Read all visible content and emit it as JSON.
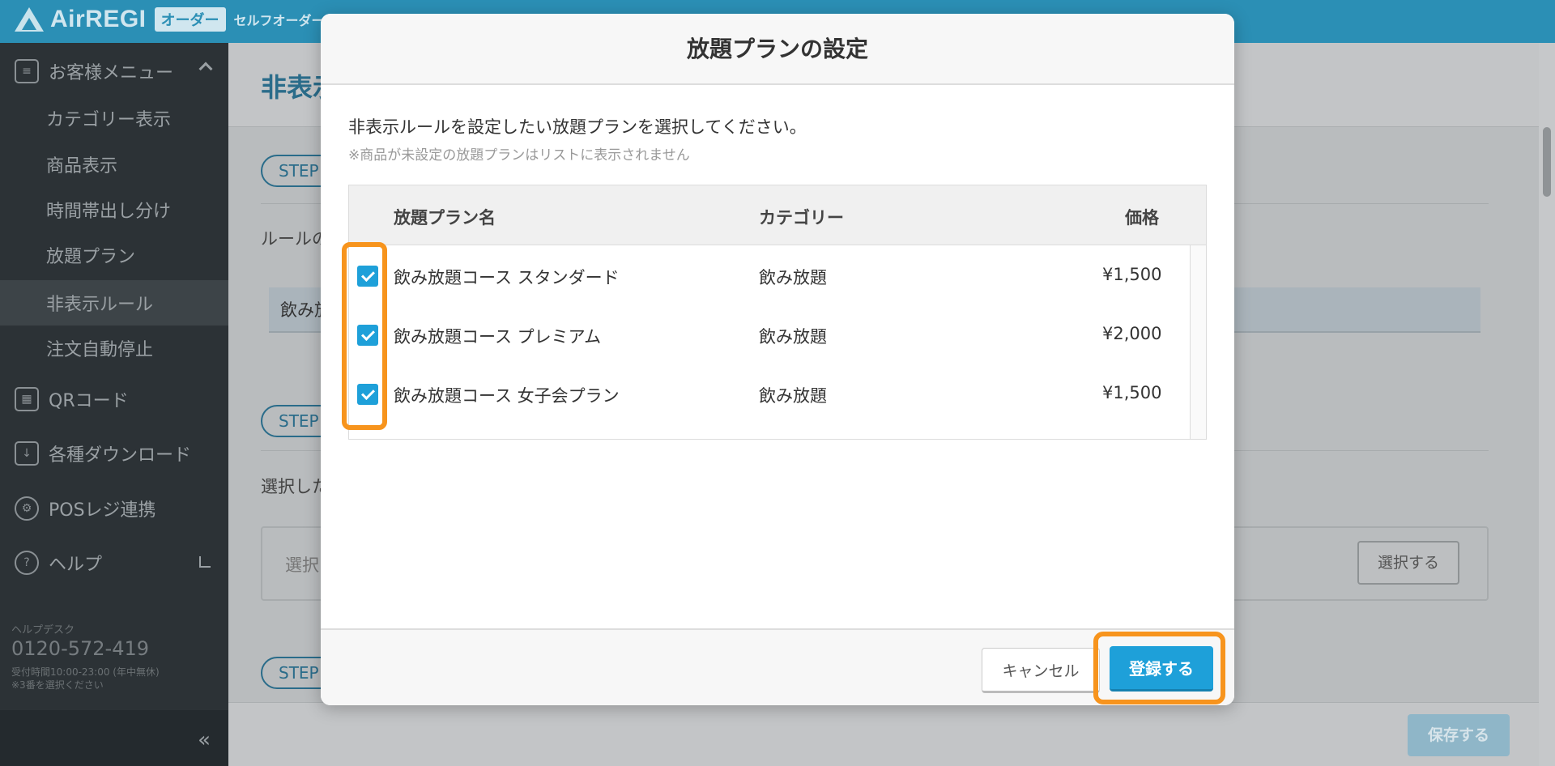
{
  "header": {
    "brand_name": "AirREGI",
    "brand_badge": "オーダー",
    "brand_sub": "セルフオーダー"
  },
  "sidebar": {
    "section_customer_menu": "お客様メニュー",
    "items": [
      {
        "label": "カテゴリー表示"
      },
      {
        "label": "商品表示"
      },
      {
        "label": "時間帯出し分け"
      },
      {
        "label": "放題プラン"
      },
      {
        "label": "非表示ルール"
      },
      {
        "label": "注文自動停止"
      }
    ],
    "section_qr": "QRコード",
    "section_download": "各種ダウンロード",
    "section_pos": "POSレジ連携",
    "section_help": "ヘルプ",
    "helpdesk_label": "ヘルプデスク",
    "helpdesk_phone": "0120-572-419",
    "helpdesk_hours": "受付時間10:00-23:00 (年中無休)",
    "helpdesk_note": "※3番を選択ください",
    "collapse_glyph": "«"
  },
  "background": {
    "title": "非表示",
    "step_label": "STEP",
    "rule_label": "ルールの",
    "field_value": "飲み放",
    "selected_label": "選択した",
    "select_placeholder": "選択",
    "select_button": "選択する",
    "save_button": "保存する"
  },
  "modal": {
    "title": "放題プランの設定",
    "description": "非表示ルールを設定したい放題プランを選択してください。",
    "note": "※商品が未設定の放題プランはリストに表示されません",
    "columns": {
      "name": "放題プラン名",
      "category": "カテゴリー",
      "price": "価格"
    },
    "rows": [
      {
        "name": "飲み放題コース スタンダード",
        "category": "飲み放題",
        "price": "¥1,500",
        "checked": true
      },
      {
        "name": "飲み放題コース プレミアム",
        "category": "飲み放題",
        "price": "¥2,000",
        "checked": true
      },
      {
        "name": "飲み放題コース 女子会プラン",
        "category": "飲み放題",
        "price": "¥1,500",
        "checked": true
      }
    ],
    "cancel_button": "キャンセル",
    "submit_button": "登録する"
  }
}
